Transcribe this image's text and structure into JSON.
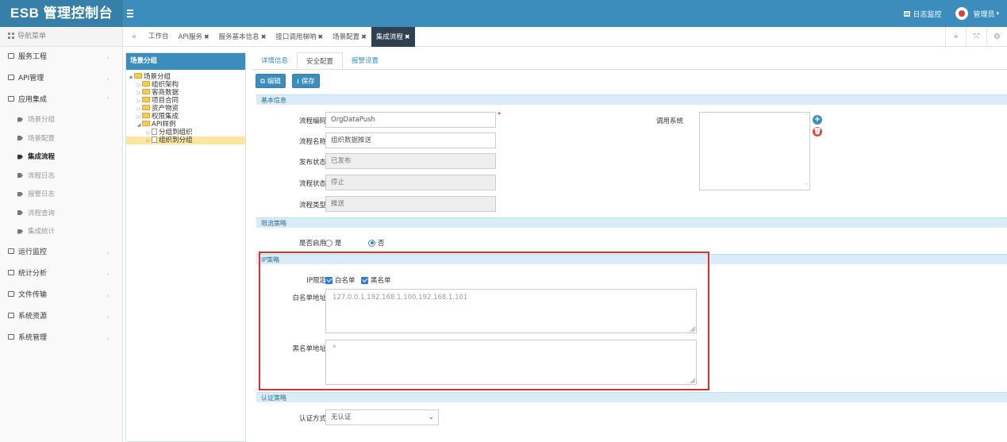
{
  "app": {
    "title": "ESB 管理控制台"
  },
  "header": {
    "log_label": "日志监控",
    "user_label": "管理员"
  },
  "sidebar": {
    "nav_title": "导航菜单",
    "items": [
      {
        "label": "服务工程"
      },
      {
        "label": "API管理"
      },
      {
        "label": "应用集成",
        "expanded": true,
        "sub": [
          {
            "label": "场景分组"
          },
          {
            "label": "场景配置"
          },
          {
            "label": "集成流程",
            "active": true
          },
          {
            "label": "流程日志"
          },
          {
            "label": "报警日志"
          },
          {
            "label": "流程查询"
          },
          {
            "label": "集成统计"
          }
        ]
      },
      {
        "label": "运行监控"
      },
      {
        "label": "统计分析"
      },
      {
        "label": "文件传输"
      },
      {
        "label": "系统资源"
      },
      {
        "label": "系统管理"
      }
    ]
  },
  "tabs": [
    {
      "label": "工作台",
      "closable": false
    },
    {
      "label": "API服务",
      "closable": true
    },
    {
      "label": "服务基本信息",
      "closable": true
    },
    {
      "label": "接口调用梯响",
      "closable": true
    },
    {
      "label": "场景配置",
      "closable": true
    },
    {
      "label": "集成流程",
      "closable": true,
      "active": true
    }
  ],
  "tree": {
    "title": "场景分组",
    "nodes": [
      {
        "label": "场景分组",
        "type": "folder",
        "toggle": "▪"
      },
      {
        "label": "组织架构",
        "type": "folder",
        "toggle": "▷"
      },
      {
        "label": "客商数据",
        "type": "folder",
        "toggle": "▷"
      },
      {
        "label": "项目合同",
        "type": "folder",
        "toggle": "▷"
      },
      {
        "label": "资产物资",
        "type": "folder",
        "toggle": "▷"
      },
      {
        "label": "权限集成",
        "type": "folder",
        "toggle": "▷"
      },
      {
        "label": "API样例",
        "type": "folder",
        "toggle": "◢"
      },
      {
        "label": "分组到组织",
        "type": "file",
        "toggle": "▷"
      },
      {
        "label": "组织到分组",
        "type": "file",
        "toggle": "▷",
        "selected": true
      }
    ]
  },
  "detail_tabs": [
    {
      "label": "详情信息"
    },
    {
      "label": "安全配置",
      "active": true
    },
    {
      "label": "报警设置"
    }
  ],
  "toolbar": {
    "edit_label": "编辑",
    "save_label": "保存"
  },
  "basic": {
    "section_title": "基本信息",
    "code_label": "流程编码",
    "code_value": "OrgDataPush",
    "name_label": "流程名称",
    "name_value": "组织数据推送",
    "publish_label": "发布状态",
    "publish_value": "已发布",
    "status_label": "流程状态",
    "status_value": "停止",
    "type_label": "流程类型",
    "type_value": "推送",
    "caller_label": "调用系统"
  },
  "rate": {
    "section_title": "限流策略",
    "enable_label": "是否启用",
    "options": [
      {
        "label": "是",
        "checked": false
      },
      {
        "label": "否",
        "checked": true
      }
    ]
  },
  "ip": {
    "section_title": "IP策略",
    "limit_label": "IP限定",
    "checks": [
      {
        "label": "白名单",
        "checked": true
      },
      {
        "label": "黑名单",
        "checked": true
      }
    ],
    "white_label": "白名单地址",
    "white_value": "127.0.0.1,192.168.1.100,192.168.1.101",
    "black_label": "黑名单地址",
    "black_value": "*"
  },
  "auth": {
    "section_title": "认证策略",
    "mode_label": "认证方式",
    "mode_value": "无认证"
  },
  "colors": {
    "header": "#3c8dbc",
    "brand_bg": "#367fa9",
    "active_tab": "#2f4050",
    "highlight": "#d9302e"
  }
}
